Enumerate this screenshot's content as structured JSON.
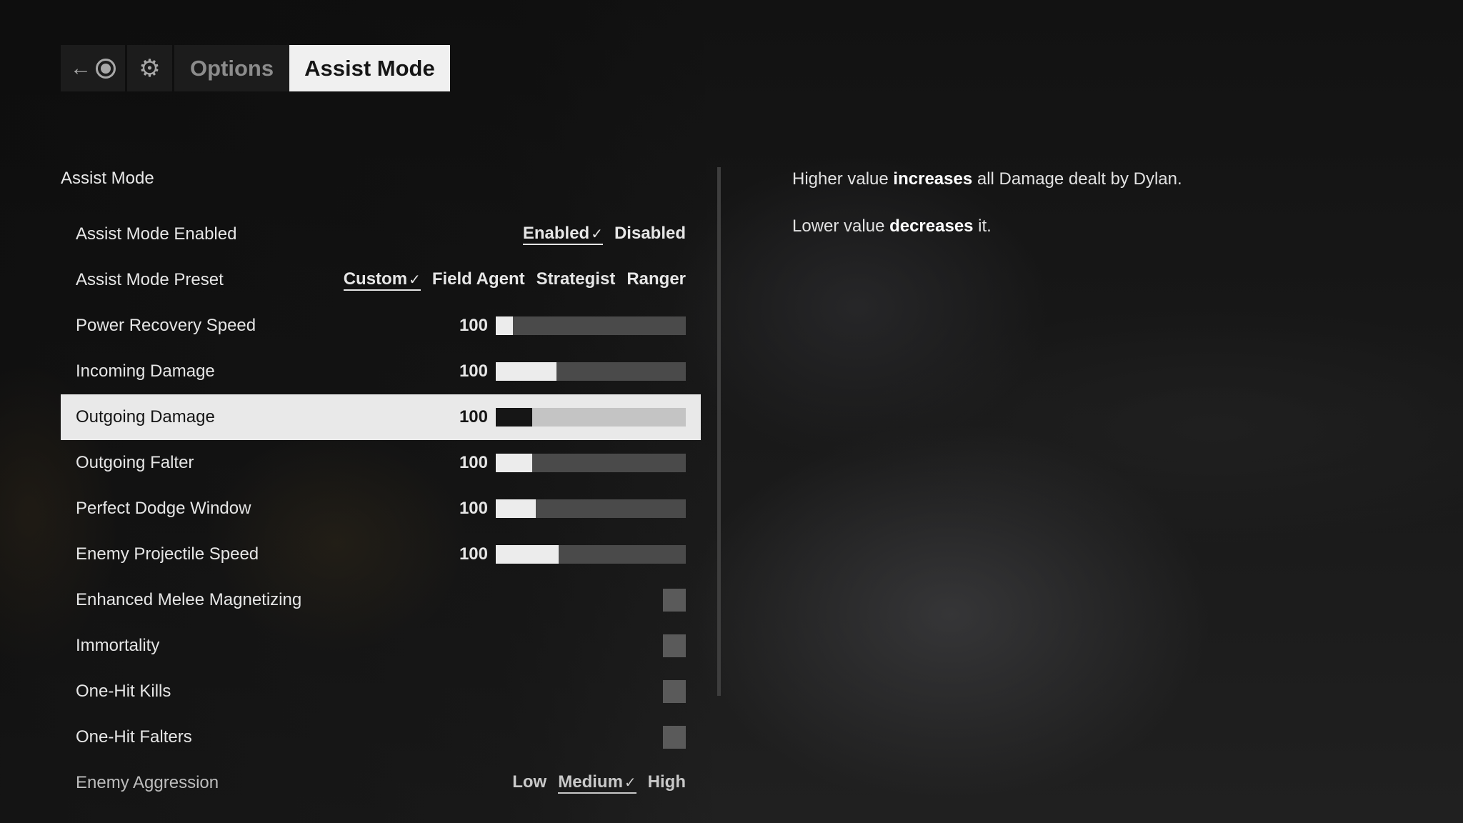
{
  "header": {
    "options_label": "Options",
    "active_tab_label": "Assist Mode",
    "back_glyph": "←",
    "gear_glyph": "⚙"
  },
  "section_title": "Assist Mode",
  "settings": {
    "assist_mode_enabled": {
      "label": "Assist Mode Enabled",
      "options": [
        "Enabled",
        "Disabled"
      ],
      "selected": "Enabled"
    },
    "assist_mode_preset": {
      "label": "Assist Mode Preset",
      "options": [
        "Custom",
        "Field Agent",
        "Strategist",
        "Ranger"
      ],
      "selected": "Custom"
    },
    "power_recovery_speed": {
      "label": "Power Recovery Speed",
      "value": "100",
      "fill_fraction": 0.09
    },
    "incoming_damage": {
      "label": "Incoming Damage",
      "value": "100",
      "fill_fraction": 0.32
    },
    "outgoing_damage": {
      "label": "Outgoing Damage",
      "value": "100",
      "fill_fraction": 0.19
    },
    "outgoing_falter": {
      "label": "Outgoing Falter",
      "value": "100",
      "fill_fraction": 0.19
    },
    "perfect_dodge_window": {
      "label": "Perfect Dodge Window",
      "value": "100",
      "fill_fraction": 0.21
    },
    "enemy_projectile_speed": {
      "label": "Enemy Projectile Speed",
      "value": "100",
      "fill_fraction": 0.33
    },
    "enhanced_melee_magnetizing": {
      "label": "Enhanced Melee Magnetizing",
      "checked": false
    },
    "immortality": {
      "label": "Immortality",
      "checked": false
    },
    "one_hit_kills": {
      "label": "One-Hit Kills",
      "checked": false
    },
    "one_hit_falters": {
      "label": "One-Hit Falters",
      "checked": false
    },
    "enemy_aggression": {
      "label": "Enemy Aggression",
      "options": [
        "Low",
        "Medium",
        "High"
      ],
      "selected": "Medium"
    }
  },
  "check_glyph": "✓",
  "description": {
    "line1_pre": "Higher value ",
    "line1_bold": "increases",
    "line1_post": " all Damage dealt by Dylan.",
    "line2_pre": "Lower value ",
    "line2_bold": "decreases",
    "line2_post": " it."
  },
  "colors": {
    "selected_row_bg": "#e9e9e9",
    "active_tab_bg": "#f0f0f0",
    "bar_track": "#4a4a4a",
    "bar_fill": "#ececec"
  }
}
